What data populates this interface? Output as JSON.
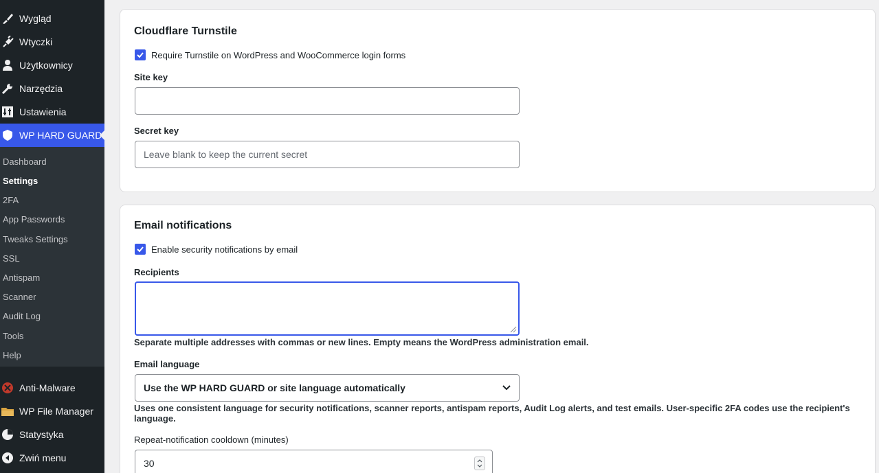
{
  "sidebar": {
    "top_items": [
      {
        "label": "Wygląd",
        "icon": "paintbrush-icon"
      },
      {
        "label": "Wtyczki",
        "icon": "plugin-icon"
      },
      {
        "label": "Użytkownicy",
        "icon": "users-icon"
      },
      {
        "label": "Narzędzia",
        "icon": "wrench-icon"
      },
      {
        "label": "Ustawienia",
        "icon": "settings-sliders-icon"
      },
      {
        "label": "WP HARD GUARD",
        "icon": "shield-icon",
        "active": true
      }
    ],
    "submenu": [
      {
        "label": "Dashboard"
      },
      {
        "label": "Settings",
        "current": true
      },
      {
        "label": "2FA"
      },
      {
        "label": "App Passwords"
      },
      {
        "label": "Tweaks Settings"
      },
      {
        "label": "SSL"
      },
      {
        "label": "Antispam"
      },
      {
        "label": "Scanner"
      },
      {
        "label": "Audit Log"
      },
      {
        "label": "Tools"
      },
      {
        "label": "Help"
      }
    ],
    "bottom_items": [
      {
        "label": "Anti-Malware",
        "icon": "antimalware-icon"
      },
      {
        "label": "WP File Manager",
        "icon": "folder-icon"
      },
      {
        "label": "Statystyka",
        "icon": "pie-chart-icon"
      },
      {
        "label": "Zwiń menu",
        "icon": "collapse-icon"
      }
    ],
    "accent_color": "#3858e9"
  },
  "turnstile": {
    "title": "Cloudflare Turnstile",
    "require_label": "Require Turnstile on WordPress and WooCommerce login forms",
    "require_checked": true,
    "site_key_label": "Site key",
    "site_key_value": "",
    "secret_key_label": "Secret key",
    "secret_key_placeholder": "Leave blank to keep the current secret"
  },
  "email": {
    "title": "Email notifications",
    "enable_label": "Enable security notifications by email",
    "enable_checked": true,
    "recipients_label": "Recipients",
    "recipients_value": "",
    "recipients_help": "Separate multiple addresses with commas or new lines. Empty means the WordPress administration email.",
    "language_label": "Email language",
    "language_selected": "Use the WP HARD GUARD or site language automatically",
    "language_help": "Uses one consistent language for security notifications, scanner reports, antispam reports, Audit Log alerts, and test emails. User-specific 2FA codes use the recipient's language.",
    "cooldown_label": "Repeat-notification cooldown (minutes)",
    "cooldown_value": "30"
  }
}
